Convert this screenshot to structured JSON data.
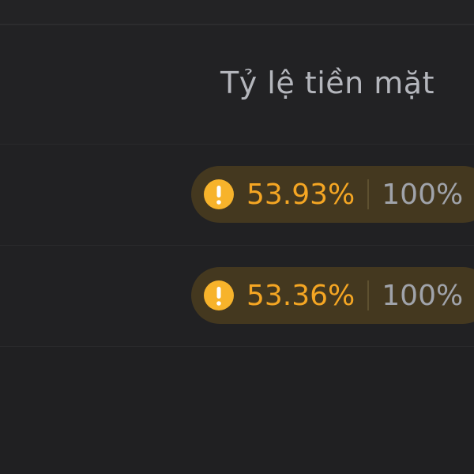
{
  "table": {
    "header": {
      "cash_ratio_label": "Tỷ lệ tiền mặt"
    },
    "rows": [
      {
        "status_icon": "exclamation-warning-icon",
        "cash_ratio": "53.93%",
        "target_ratio": "100%"
      },
      {
        "status_icon": "exclamation-warning-icon",
        "cash_ratio": "53.36%",
        "target_ratio": "100%"
      }
    ]
  },
  "colors": {
    "warning_accent": "#f5a623",
    "pill_background": "#44381f",
    "page_background": "#202022",
    "header_text": "#b4b6bc",
    "target_text": "#a0a3aa"
  }
}
